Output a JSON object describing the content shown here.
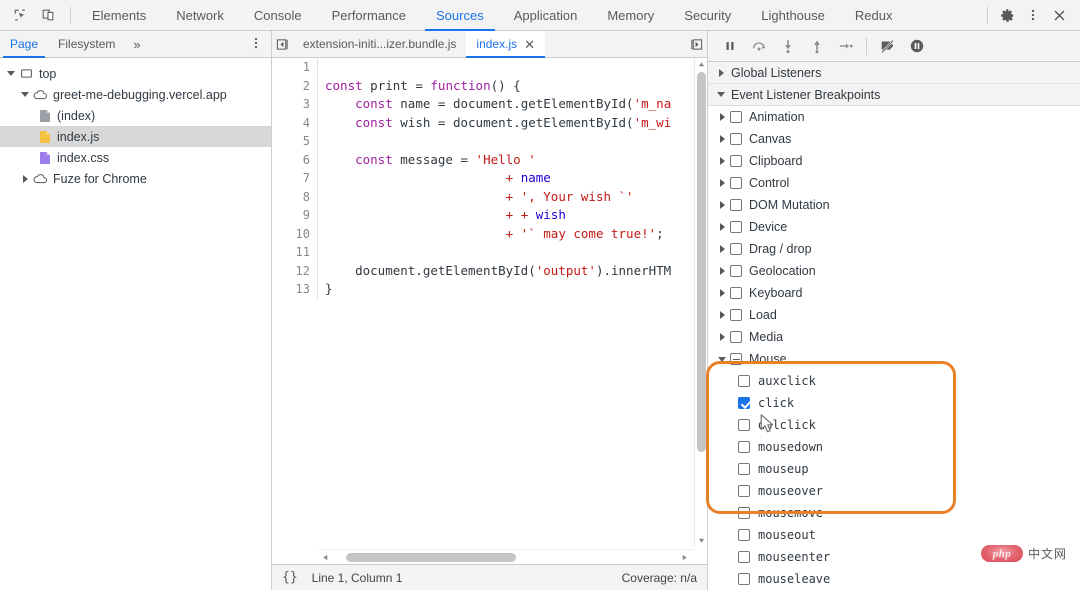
{
  "toolbar": {
    "icons": [
      {
        "name": "inspect-element-icon",
        "label": "Inspect element"
      },
      {
        "name": "device-toolbar-icon",
        "label": "Toggle device toolbar"
      }
    ],
    "tabs": [
      {
        "label": "Elements",
        "active": false
      },
      {
        "label": "Network",
        "active": false
      },
      {
        "label": "Console",
        "active": false
      },
      {
        "label": "Performance",
        "active": false
      },
      {
        "label": "Sources",
        "active": true
      },
      {
        "label": "Application",
        "active": false
      },
      {
        "label": "Memory",
        "active": false
      },
      {
        "label": "Security",
        "active": false
      },
      {
        "label": "Lighthouse",
        "active": false
      },
      {
        "label": "Redux",
        "active": false
      }
    ],
    "right_icons": [
      {
        "name": "settings-gear-icon",
        "label": "Settings"
      },
      {
        "name": "kebab-menu-icon",
        "label": "Customize and control DevTools"
      },
      {
        "name": "close-icon",
        "label": "Close DevTools"
      }
    ],
    "accent_color": "#1a73e8"
  },
  "navigator": {
    "tabs": [
      {
        "label": "Page",
        "active": true
      },
      {
        "label": "Filesystem",
        "active": false
      }
    ],
    "more_label": "»",
    "kebab_label": "More options",
    "tree": [
      {
        "label": "top",
        "icon": "frame-icon",
        "expanded": true,
        "depth": 0,
        "selected": false
      },
      {
        "label": "greet-me-debugging.vercel.app",
        "icon": "cloud-icon",
        "expanded": true,
        "depth": 1,
        "selected": false
      },
      {
        "label": "(index)",
        "icon": "document-icon",
        "expanded": null,
        "depth": 2,
        "selected": false
      },
      {
        "label": "index.js",
        "icon": "js-file-icon",
        "expanded": null,
        "depth": 2,
        "selected": true
      },
      {
        "label": "index.css",
        "icon": "css-file-icon",
        "expanded": null,
        "depth": 2,
        "selected": false
      },
      {
        "label": "Fuze for Chrome",
        "icon": "cloud-icon",
        "expanded": false,
        "depth": 1,
        "selected": false
      }
    ]
  },
  "editor": {
    "prev_tab_label": "◀",
    "next_tab_label": "▶",
    "tabs": [
      {
        "label": "extension-initi...izer.bundle.js",
        "active": false,
        "closable": false
      },
      {
        "label": "index.js",
        "active": true,
        "closable": true,
        "close_label": "✕"
      }
    ],
    "code_lines": [
      {
        "num": "1",
        "tokens": []
      },
      {
        "num": "2",
        "tokens": [
          {
            "t": "const",
            "c": "kw"
          },
          {
            "t": " print ",
            "c": "ident"
          },
          {
            "t": "=",
            "c": "op"
          },
          {
            "t": " ",
            "c": "ident"
          },
          {
            "t": "function",
            "c": "kw"
          },
          {
            "t": "() {",
            "c": "op"
          }
        ]
      },
      {
        "num": "3",
        "tokens": [
          {
            "t": "    ",
            "c": "op"
          },
          {
            "t": "const",
            "c": "kw"
          },
          {
            "t": " name ",
            "c": "ident"
          },
          {
            "t": "=",
            "c": "op"
          },
          {
            "t": " document.getElementById(",
            "c": "ident"
          },
          {
            "t": "'m_na",
            "c": "str"
          }
        ]
      },
      {
        "num": "4",
        "tokens": [
          {
            "t": "    ",
            "c": "op"
          },
          {
            "t": "const",
            "c": "kw"
          },
          {
            "t": " wish ",
            "c": "ident"
          },
          {
            "t": "=",
            "c": "op"
          },
          {
            "t": " document.getElementById(",
            "c": "ident"
          },
          {
            "t": "'m_wi",
            "c": "str"
          }
        ]
      },
      {
        "num": "5",
        "tokens": []
      },
      {
        "num": "6",
        "tokens": [
          {
            "t": "    ",
            "c": "op"
          },
          {
            "t": "const",
            "c": "kw"
          },
          {
            "t": " message ",
            "c": "ident"
          },
          {
            "t": "=",
            "c": "op"
          },
          {
            "t": " ",
            "c": "ident"
          },
          {
            "t": "'Hello '",
            "c": "str"
          }
        ]
      },
      {
        "num": "7",
        "tokens": [
          {
            "t": "                        ",
            "c": "op"
          },
          {
            "t": "+",
            "c": "str"
          },
          {
            "t": " ",
            "c": "ident"
          },
          {
            "t": "name",
            "c": "blue"
          }
        ]
      },
      {
        "num": "8",
        "tokens": [
          {
            "t": "                        ",
            "c": "op"
          },
          {
            "t": "+",
            "c": "str"
          },
          {
            "t": " ",
            "c": "ident"
          },
          {
            "t": "', Your wish `'",
            "c": "str"
          }
        ]
      },
      {
        "num": "9",
        "tokens": [
          {
            "t": "                        ",
            "c": "op"
          },
          {
            "t": "+",
            "c": "str"
          },
          {
            "t": " ",
            "c": "ident"
          },
          {
            "t": "+",
            "c": "str"
          },
          {
            "t": " ",
            "c": "ident"
          },
          {
            "t": "wish",
            "c": "blue"
          }
        ]
      },
      {
        "num": "10",
        "tokens": [
          {
            "t": "                        ",
            "c": "op"
          },
          {
            "t": "+",
            "c": "str"
          },
          {
            "t": " ",
            "c": "ident"
          },
          {
            "t": "'` may come true!'",
            "c": "str"
          },
          {
            "t": ";",
            "c": "op"
          }
        ]
      },
      {
        "num": "11",
        "tokens": []
      },
      {
        "num": "12",
        "tokens": [
          {
            "t": "    document.getElementById(",
            "c": "ident"
          },
          {
            "t": "'output'",
            "c": "str"
          },
          {
            "t": ").innerHTM",
            "c": "ident"
          }
        ]
      },
      {
        "num": "13",
        "tokens": [
          {
            "t": "}",
            "c": "op"
          }
        ]
      }
    ],
    "statusbar": {
      "format_label": "{}",
      "position": "Line 1, Column 1",
      "coverage": "Coverage: n/a"
    }
  },
  "debugger": {
    "controls": [
      {
        "name": "resume-script-button",
        "label": "Resume script execution"
      },
      {
        "name": "step-over-button",
        "label": "Step over next function call"
      },
      {
        "name": "step-into-button",
        "label": "Step into next function call"
      },
      {
        "name": "step-out-button",
        "label": "Step out of current function"
      },
      {
        "name": "step-button",
        "label": "Step"
      },
      {
        "name": "deactivate-breakpoints-button",
        "label": "Deactivate breakpoints"
      },
      {
        "name": "pause-on-exceptions-button",
        "label": "Pause on exceptions"
      }
    ],
    "sections": [
      {
        "label": "Global Listeners",
        "expanded": false
      },
      {
        "label": "Event Listener Breakpoints",
        "expanded": true
      }
    ],
    "breakpoint_groups": [
      {
        "label": "Animation",
        "state": "unchecked",
        "expanded": false
      },
      {
        "label": "Canvas",
        "state": "unchecked",
        "expanded": false
      },
      {
        "label": "Clipboard",
        "state": "unchecked",
        "expanded": false
      },
      {
        "label": "Control",
        "state": "unchecked",
        "expanded": false
      },
      {
        "label": "DOM Mutation",
        "state": "unchecked",
        "expanded": false
      },
      {
        "label": "Device",
        "state": "unchecked",
        "expanded": false
      },
      {
        "label": "Drag / drop",
        "state": "unchecked",
        "expanded": false
      },
      {
        "label": "Geolocation",
        "state": "unchecked",
        "expanded": false
      },
      {
        "label": "Keyboard",
        "state": "unchecked",
        "expanded": false
      },
      {
        "label": "Load",
        "state": "unchecked",
        "expanded": false
      },
      {
        "label": "Media",
        "state": "unchecked",
        "expanded": false
      },
      {
        "label": "Mouse",
        "state": "indeterminate",
        "expanded": true
      }
    ],
    "mouse_events": [
      {
        "label": "auxclick",
        "state": "unchecked"
      },
      {
        "label": "click",
        "state": "checked"
      },
      {
        "label": "dblclick",
        "state": "unchecked"
      },
      {
        "label": "mousedown",
        "state": "unchecked"
      },
      {
        "label": "mouseup",
        "state": "unchecked"
      },
      {
        "label": "mouseover",
        "state": "unchecked"
      },
      {
        "label": "mousemove",
        "state": "unchecked"
      },
      {
        "label": "mouseout",
        "state": "unchecked"
      },
      {
        "label": "mouseenter",
        "state": "unchecked"
      },
      {
        "label": "mouseleave",
        "state": "unchecked"
      }
    ]
  },
  "annotation": {
    "highlight_color": "#e8812a",
    "cursor_name": "mouse-cursor-pointer"
  },
  "watermark": {
    "logo_text": "php",
    "site_text": "中文网"
  }
}
